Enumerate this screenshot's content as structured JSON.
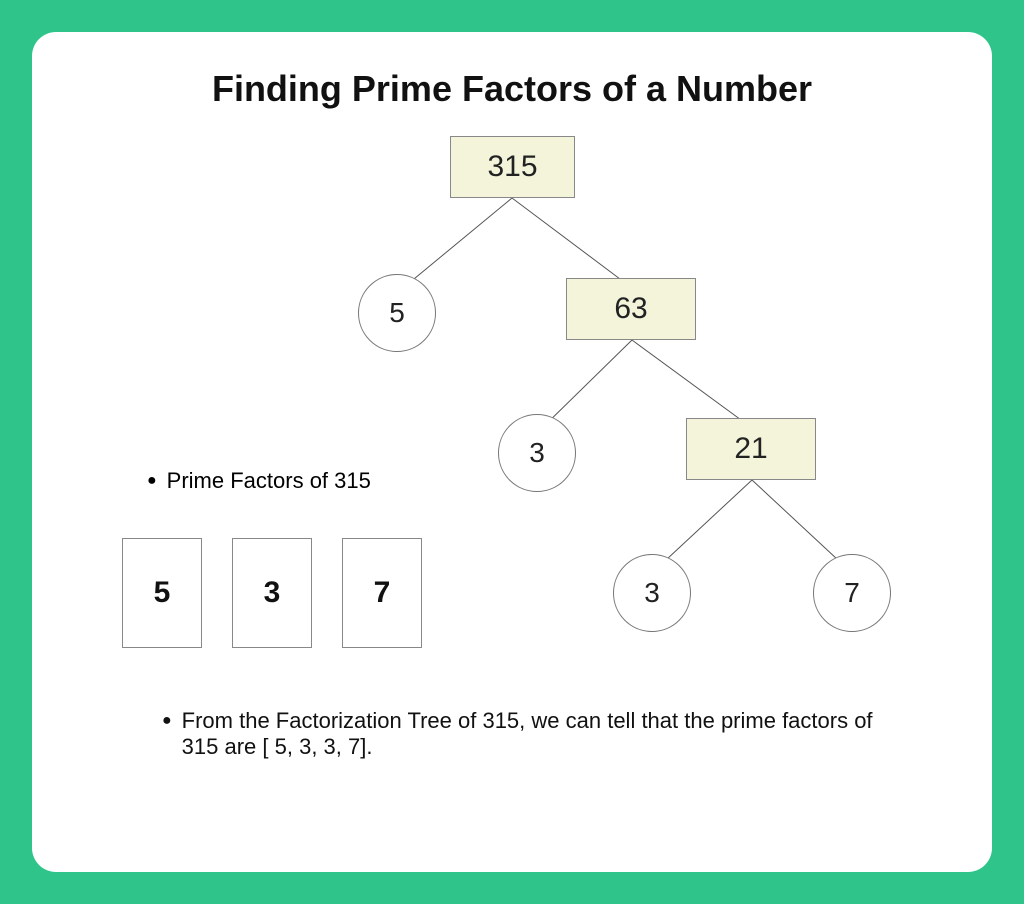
{
  "title": "Finding Prime Factors of a Number",
  "tree": {
    "root": "315",
    "l1_left": "5",
    "l1_right": "63",
    "l2_left": "3",
    "l2_right": "21",
    "l3_left": "3",
    "l3_right": "7"
  },
  "primeFactorsLabel": "Prime Factors of 315",
  "primeFactors": [
    "5",
    "3",
    "7"
  ],
  "explanation": "From the Factorization Tree of 315, we can tell that the prime factors of 315 are [ 5, 3, 3, 7].",
  "chart_data": {
    "type": "table",
    "title": "Factorization Tree of 315",
    "nodes": [
      {
        "value": 315,
        "children": [
          5,
          63
        ]
      },
      {
        "value": 63,
        "children": [
          3,
          21
        ]
      },
      {
        "value": 21,
        "children": [
          3,
          7
        ]
      }
    ],
    "prime_factors_distinct": [
      5,
      3,
      7
    ],
    "prime_factorization": [
      5,
      3,
      3,
      7
    ]
  }
}
